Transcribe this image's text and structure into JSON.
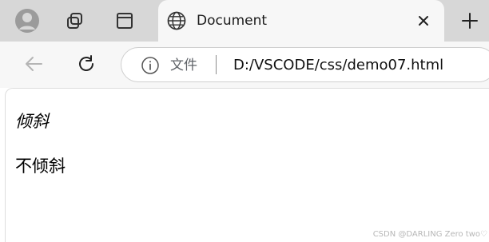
{
  "tabstrip": {
    "profile_icon": "profile-icon",
    "workspace_icon": "workspaces-icon",
    "vertical_tabs_icon": "vertical-tabs-icon",
    "active_tab": {
      "title": "Document",
      "favicon": "globe-icon",
      "close_icon": "close-icon"
    },
    "new_tab_icon": "plus-icon"
  },
  "toolbar": {
    "back_icon": "back-arrow-icon",
    "refresh_icon": "refresh-icon",
    "address": {
      "info_icon": "info-icon",
      "scheme_label": "文件",
      "url": "D:/VSCODE/css/demo07.html"
    }
  },
  "page": {
    "italic_text": "倾斜",
    "normal_text": "不倾斜"
  },
  "watermark": "CSDN @DARLING Zero two♡",
  "colors": {
    "tabstrip_background": "#d7d7d7",
    "toolbar_background": "#f7f7f7",
    "page_background": "#ffffff",
    "text": "#000000",
    "icon": "#333333"
  }
}
